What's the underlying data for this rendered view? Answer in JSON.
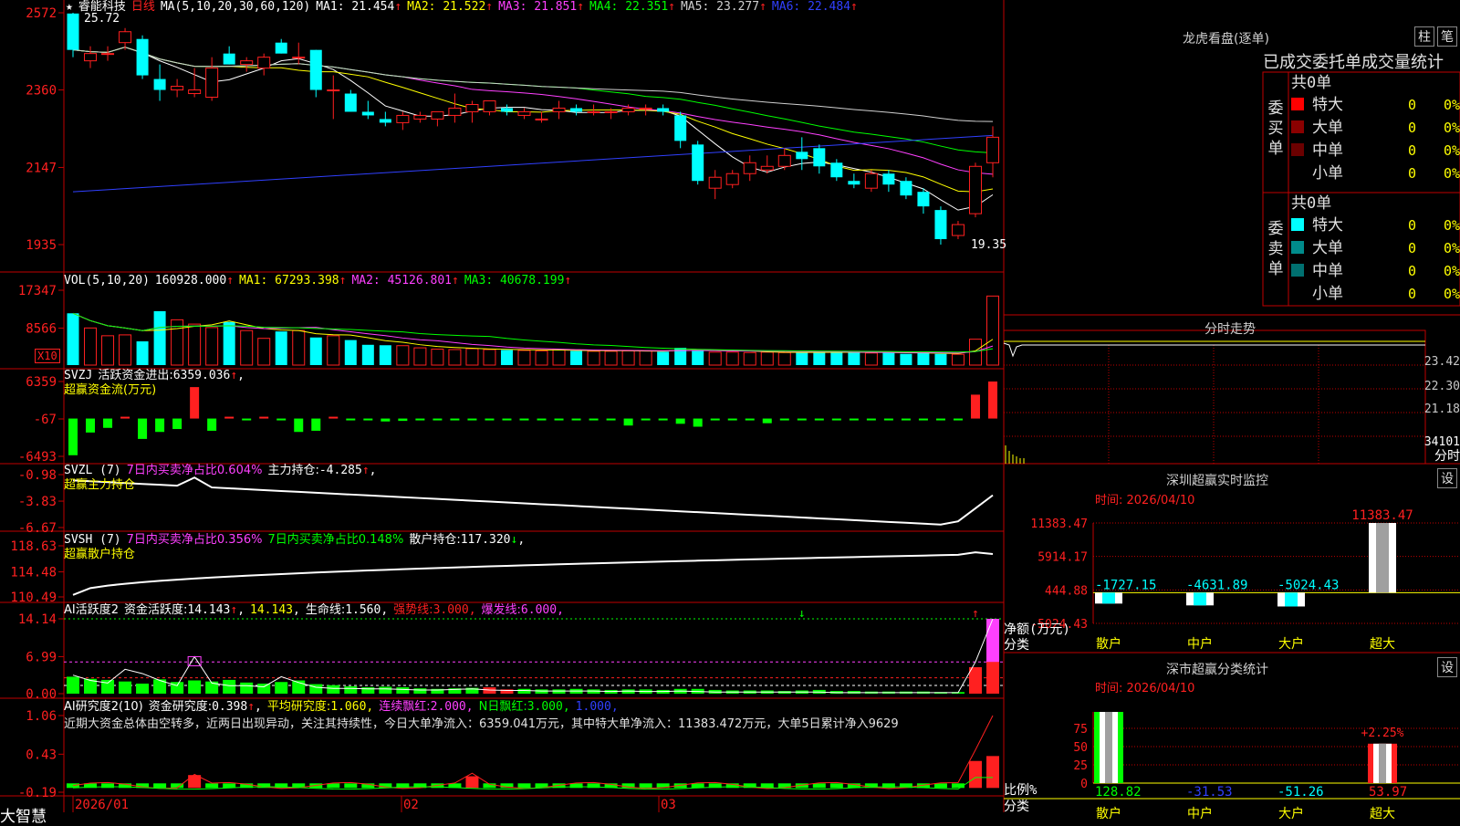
{
  "app": {
    "brand": "大智慧"
  },
  "colors": {
    "bg": "#000000",
    "grid": "#c00000",
    "up": "#ff2020",
    "down": "#00ffff",
    "text": "#c8c8c8",
    "yellow": "#ffff00",
    "magenta": "#ff40ff",
    "green": "#00ff00",
    "white": "#ffffff",
    "blue": "#3040ff",
    "gray": "#a0a0a0"
  },
  "price": {
    "stock_name": "睿能科技",
    "period": "日线",
    "ma_def": "MA(5,10,20,30,60,120)",
    "ma": [
      {
        "label": "MA1:",
        "value": "21.454",
        "color": "#ffffff"
      },
      {
        "label": "MA2:",
        "value": "21.522",
        "color": "#ffff00"
      },
      {
        "label": "MA3:",
        "value": "21.851",
        "color": "#ff40ff"
      },
      {
        "label": "MA4:",
        "value": "22.351",
        "color": "#00ff00"
      },
      {
        "label": "MA5:",
        "value": "23.277",
        "color": "#d0d0d0"
      },
      {
        "label": "MA6:",
        "value": "22.484",
        "color": "#3040ff"
      }
    ],
    "y_ticks": [
      "2572",
      "2360",
      "2147",
      "1935"
    ],
    "high_label": "25.72",
    "low_label": "19.35",
    "arrow": "↑"
  },
  "vol": {
    "def": "VOL(5,10,20)",
    "value": "160928.000",
    "ma1": "MA1: 67293.398",
    "ma2": "MA2: 45126.801",
    "ma3": "MA3: 40678.199",
    "y_ticks": [
      "17347",
      "8566"
    ],
    "unit": "X10"
  },
  "svzj": {
    "name": "SVZJ",
    "label": "活跃资金进出:",
    "value": "6359.036",
    "sub": "超赢资金流(万元)",
    "y_ticks": [
      "6359",
      "-67",
      "-6493"
    ]
  },
  "svzl": {
    "name": "SVZL (7)",
    "t1": "7日内买卖净占比0.604%",
    "t2": "主力持仓:",
    "v2": "-4.285",
    "sub": "超赢主力持仓",
    "y_ticks": [
      "-0.98",
      "-3.83",
      "-6.67"
    ]
  },
  "svsh": {
    "name": "SVSH (7)",
    "t1": "7日内买卖净占比0.356%",
    "t2": "7日内买卖净占比0.148%",
    "t3": "散户持仓:",
    "v3": "117.320",
    "arrow_down": "↓",
    "sub": "超赢散户持仓",
    "y_ticks": [
      "118.63",
      "114.48",
      "110.49"
    ]
  },
  "ai1": {
    "name": "AI活跃度2",
    "t1": "资金活跃度:",
    "v1": "14.143",
    "v2": "14.143",
    "t3": "生命线:",
    "v3": "1.560",
    "t4": "强势线:",
    "v4": "3.000",
    "t5": "爆发线:",
    "v5": "6.000",
    "y_ticks": [
      "14.14",
      "6.99",
      "0.00"
    ]
  },
  "ai2": {
    "name": "AI研究度2(10)",
    "t1": "资金研究度:",
    "v1": "0.398",
    "t2": "平均研究度:",
    "v2": "1.060",
    "t3": "连续飘红:",
    "v3": "2.000",
    "t4": "N日飘红:",
    "v4": "3.000",
    "v5": "1.000",
    "comment": "近期大资金总体由空转多，近两日出现异动，关注其持续性，今日大单净流入：6359.041万元，其中特大单净流入：11383.472万元，大单5日累计净入9629",
    "y_ticks": [
      "1.06",
      "0.43",
      "-0.19"
    ]
  },
  "xaxis": {
    "labels": [
      "2026/01",
      "02",
      "03"
    ]
  },
  "dragon": {
    "title": "龙虎看盘(逐单)",
    "btn1": "柱",
    "btn2": "笔",
    "header": "已成交委托单成交量统计",
    "buy": {
      "side": "委买单",
      "total": "共0单",
      "rows": [
        {
          "label": "特大",
          "count": "0",
          "pct": "0%",
          "color": "#ff0000"
        },
        {
          "label": "大单",
          "count": "0",
          "pct": "0%",
          "color": "#8b0000"
        },
        {
          "label": "中单",
          "count": "0",
          "pct": "0%",
          "color": "#6b0000"
        },
        {
          "label": "小单",
          "count": "0",
          "pct": "0%",
          "color": ""
        }
      ]
    },
    "sell": {
      "side": "委卖单",
      "total": "共0单",
      "rows": [
        {
          "label": "特大",
          "count": "0",
          "pct": "0%",
          "color": "#00ffff"
        },
        {
          "label": "大单",
          "count": "0",
          "pct": "0%",
          "color": "#008b8b"
        },
        {
          "label": "中单",
          "count": "0",
          "pct": "0%",
          "color": "#007070"
        },
        {
          "label": "小单",
          "count": "0",
          "pct": "0%",
          "color": ""
        }
      ]
    }
  },
  "intraday": {
    "title": "分时走势",
    "y_ticks": [
      "23.42",
      "22.30",
      "21.18"
    ],
    "vol_label": "34101",
    "vol_unit": "分时"
  },
  "monitor": {
    "title": "深圳超赢实时监控",
    "btn": "设",
    "time": "时间: 2026/04/10",
    "y_ticks": [
      "11383.47",
      "5914.17",
      "444.88",
      "-5024.43"
    ],
    "ylabel1": "净额(万元)",
    "ylabel2": "分类",
    "cats": [
      "散户",
      "中户",
      "大户",
      "超大"
    ],
    "values": [
      "-1727.15",
      "-4631.89",
      "-5024.43",
      "11383.47"
    ]
  },
  "classify": {
    "title": "深市超赢分类统计",
    "btn": "设",
    "time": "时间: 2026/04/10",
    "y_ticks": [
      "75",
      "50",
      "25",
      "0"
    ],
    "ylabel1": "比例%",
    "ylabel2": "分类",
    "cats": [
      "散户",
      "中户",
      "大户",
      "超大"
    ],
    "values": [
      "128.82",
      "-31.53",
      "-51.26",
      "53.97"
    ],
    "extra": "+2.25%"
  },
  "chart_data": [
    {
      "type": "candlestick",
      "title": "睿能科技 日线",
      "ylim": [
        19.35,
        25.72
      ],
      "y_tick_labels": [
        "2572",
        "2360",
        "2147",
        "1935"
      ],
      "x_tick_labels": [
        "2026/01",
        "02",
        "03"
      ],
      "series": [
        {
          "name": "price",
          "ohlc": [
            [
              25.7,
              25.72,
              24.5,
              24.7
            ],
            [
              24.4,
              24.8,
              24.2,
              24.6
            ],
            [
              24.6,
              24.8,
              24.4,
              24.6
            ],
            [
              24.9,
              25.3,
              24.7,
              25.2
            ],
            [
              25.0,
              25.1,
              23.9,
              24.0
            ],
            [
              23.9,
              24.3,
              23.3,
              23.6
            ],
            [
              23.6,
              23.9,
              23.4,
              23.7
            ],
            [
              23.5,
              24.2,
              23.4,
              23.6
            ],
            [
              23.4,
              24.5,
              23.3,
              24.2
            ],
            [
              24.6,
              24.8,
              24.3,
              24.3
            ],
            [
              24.3,
              24.5,
              24.1,
              24.4
            ],
            [
              24.2,
              24.6,
              24.0,
              24.5
            ],
            [
              24.9,
              25.0,
              24.6,
              24.6
            ],
            [
              24.5,
              24.9,
              24.3,
              24.5
            ],
            [
              24.7,
              24.7,
              23.4,
              23.6
            ],
            [
              23.6,
              24.0,
              22.8,
              23.6
            ],
            [
              23.5,
              23.6,
              23.0,
              23.0
            ],
            [
              23.0,
              23.3,
              22.8,
              22.9
            ],
            [
              22.8,
              23.0,
              22.6,
              22.7
            ],
            [
              22.7,
              23.0,
              22.5,
              22.9
            ],
            [
              22.8,
              23.0,
              22.7,
              22.9
            ],
            [
              22.8,
              22.9,
              22.6,
              23.0
            ],
            [
              22.9,
              23.5,
              22.7,
              23.1
            ],
            [
              23.0,
              23.3,
              22.7,
              23.2
            ],
            [
              23.0,
              23.3,
              22.9,
              23.3
            ],
            [
              23.1,
              23.2,
              22.9,
              23.0
            ],
            [
              22.9,
              23.1,
              22.8,
              23.0
            ],
            [
              22.8,
              23.0,
              22.7,
              22.8
            ],
            [
              23.0,
              23.3,
              22.8,
              23.1
            ],
            [
              23.1,
              23.2,
              22.9,
              23.0
            ],
            [
              23.0,
              23.2,
              22.9,
              23.0
            ],
            [
              23.0,
              23.1,
              22.8,
              23.0
            ],
            [
              23.0,
              23.2,
              22.9,
              23.1
            ],
            [
              23.1,
              23.2,
              22.9,
              23.1
            ],
            [
              23.1,
              23.2,
              22.9,
              23.0
            ],
            [
              22.9,
              23.0,
              22.0,
              22.2
            ],
            [
              22.1,
              22.2,
              21.0,
              21.1
            ],
            [
              20.9,
              21.4,
              20.6,
              21.2
            ],
            [
              21.0,
              21.4,
              20.9,
              21.3
            ],
            [
              21.3,
              21.8,
              21.1,
              21.6
            ],
            [
              21.4,
              21.8,
              21.3,
              21.5
            ],
            [
              21.5,
              22.0,
              21.4,
              21.8
            ],
            [
              21.9,
              22.3,
              21.4,
              21.7
            ],
            [
              22.0,
              22.1,
              21.3,
              21.5
            ],
            [
              21.6,
              21.7,
              21.1,
              21.2
            ],
            [
              21.1,
              21.3,
              20.9,
              21.0
            ],
            [
              20.9,
              21.4,
              20.8,
              21.3
            ],
            [
              21.3,
              21.4,
              20.8,
              21.0
            ],
            [
              21.1,
              21.2,
              20.6,
              20.7
            ],
            [
              20.8,
              20.9,
              20.2,
              20.4
            ],
            [
              20.3,
              20.4,
              19.35,
              19.5
            ],
            [
              19.6,
              20.0,
              19.5,
              19.9
            ],
            [
              20.2,
              21.6,
              20.1,
              21.5
            ],
            [
              21.6,
              22.6,
              21.2,
              22.3
            ]
          ]
        }
      ]
    },
    {
      "type": "bar",
      "title": "VOL(5,10,20)",
      "y_tick_labels": [
        "17347",
        "8566"
      ],
      "series": [
        {
          "name": "VOL",
          "value": 160928.0
        }
      ]
    },
    {
      "type": "bar",
      "title": "SVZJ 超赢资金流(万元)",
      "y_tick_labels": [
        "6359",
        "-67",
        "-6493"
      ],
      "series": [
        {
          "name": "活跃资金进出",
          "value": 6359.036
        }
      ]
    },
    {
      "type": "line",
      "title": "SVZL (7) 超赢主力持仓",
      "y_tick_labels": [
        "-0.98",
        "-3.83",
        "-6.67"
      ],
      "series": [
        {
          "name": "主力持仓",
          "value": -4.285
        }
      ]
    },
    {
      "type": "line",
      "title": "SVSH (7) 超赢散户持仓",
      "y_tick_labels": [
        "118.63",
        "114.48",
        "110.49"
      ],
      "series": [
        {
          "name": "散户持仓",
          "value": 117.32
        }
      ]
    },
    {
      "type": "bar",
      "title": "AI活跃度2",
      "y_tick_labels": [
        "14.14",
        "6.99",
        "0.00"
      ],
      "series": [
        {
          "name": "资金活跃度",
          "value": 14.143
        }
      ]
    },
    {
      "type": "bar",
      "title": "AI研究度2(10)",
      "y_tick_labels": [
        "1.06",
        "0.43",
        "-0.19"
      ],
      "series": [
        {
          "name": "资金研究度",
          "value": 0.398
        }
      ]
    },
    {
      "type": "bar",
      "title": "深圳超赢实时监控",
      "categories": [
        "散户",
        "中户",
        "大户",
        "超大"
      ],
      "values": [
        -1727.15,
        -4631.89,
        -5024.43,
        11383.47
      ],
      "ylabel": "净额(万元)",
      "xlabel": "分类"
    },
    {
      "type": "bar",
      "title": "深市超赢分类统计",
      "categories": [
        "散户",
        "中户",
        "大户",
        "超大"
      ],
      "values": [
        128.82,
        -31.53,
        -51.26,
        53.97
      ],
      "ylabel": "比例%",
      "xlabel": "分类",
      "ylim": [
        0,
        75
      ]
    }
  ]
}
